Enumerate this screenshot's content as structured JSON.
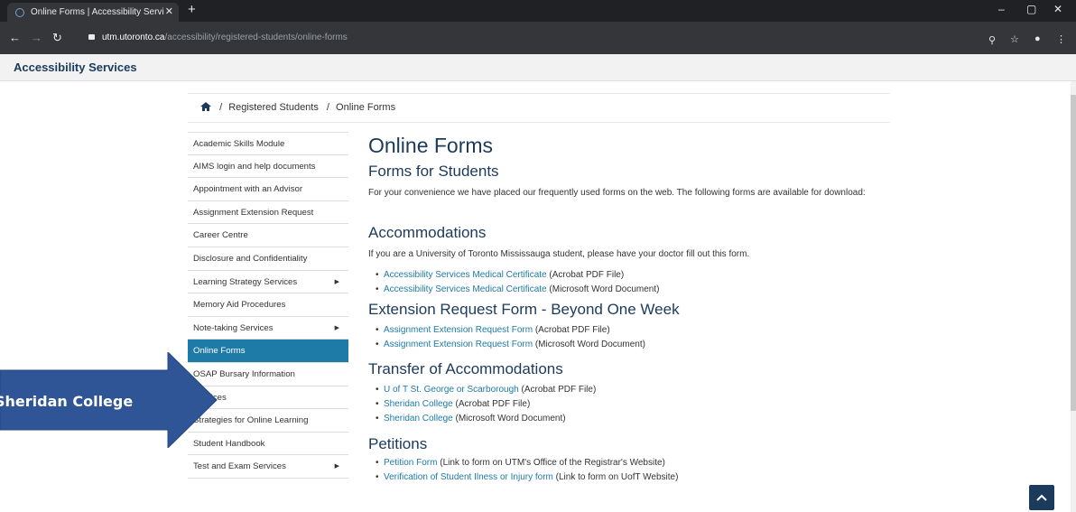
{
  "browser": {
    "tab_title": "Online Forms | Accessibility Servi",
    "tab_close": "✕",
    "new_tab": "+",
    "url_host": "utm.utoronto.ca",
    "url_path": "/accessibility/registered-students/online-forms"
  },
  "site": {
    "title": "Accessibility Services"
  },
  "breadcrumb": {
    "sep1": "/",
    "item1": "Registered Students",
    "sep2": "/",
    "item2": "Online Forms"
  },
  "sidebar": {
    "items": [
      {
        "label": "Academic Skills Module"
      },
      {
        "label": "AIMS login and help documents"
      },
      {
        "label": "Appointment with an Advisor"
      },
      {
        "label": "Assignment Extension Request"
      },
      {
        "label": "Career Centre"
      },
      {
        "label": "Disclosure and Confidentiality"
      },
      {
        "label": "Learning Strategy Services",
        "arrow": "▶"
      },
      {
        "label": "Memory Aid Procedures"
      },
      {
        "label": "Note-taking Services",
        "arrow": "▶"
      },
      {
        "label": "Online Forms"
      },
      {
        "label": "OSAP Bursary Information"
      },
      {
        "label": "Services"
      },
      {
        "label": "Strategies for Online Learning"
      },
      {
        "label": "Student Handbook"
      },
      {
        "label": "Test and Exam Services",
        "arrow": "▶"
      }
    ]
  },
  "content": {
    "title": "Online Forms",
    "subtitle": "Forms for Students",
    "intro": "For your convenience we have placed our frequently used forms on the web. The following forms are available for download:",
    "accommodations": {
      "heading": "Accommodations",
      "text": "If you are a University of Toronto Mississauga student, please have your doctor fill out this form.",
      "links": [
        {
          "link": "Accessibility Services Medical Certificate",
          "note": " (Acrobat PDF File)"
        },
        {
          "link": "Accessibility Services Medical Certificate",
          "note": " (Microsoft Word Document)"
        }
      ]
    },
    "extension": {
      "heading": "Extension Request Form - Beyond One Week",
      "links": [
        {
          "link": "Assignment Extension Request Form",
          "note": " (Acrobat PDF File)"
        },
        {
          "link": "Assignment Extension Request Form",
          "note": " (Microsoft Word Document)"
        }
      ]
    },
    "transfer": {
      "heading": "Transfer of Accommodations",
      "links": [
        {
          "link": "U of T St. George or Scarborough",
          "note": " (Acrobat PDF File)"
        },
        {
          "link": "Sheridan College",
          "note": " (Acrobat PDF File)"
        },
        {
          "link": "Sheridan College",
          "note": " (Microsoft Word Document)"
        }
      ]
    },
    "petitions": {
      "heading": "Petitions",
      "links": [
        {
          "link": "Petition Form",
          "note": " (Link to form on UTM's Office of the Registrar's Website)"
        },
        {
          "link": "Verification of Student Ilness or Injury form",
          "note": " (Link to form on UofT Website)"
        }
      ]
    }
  },
  "callout": {
    "text": "Sheridan College",
    "color": "#2f5597"
  },
  "colors": {
    "accent": "#1e7aa6",
    "heading": "#1b3a5c"
  }
}
